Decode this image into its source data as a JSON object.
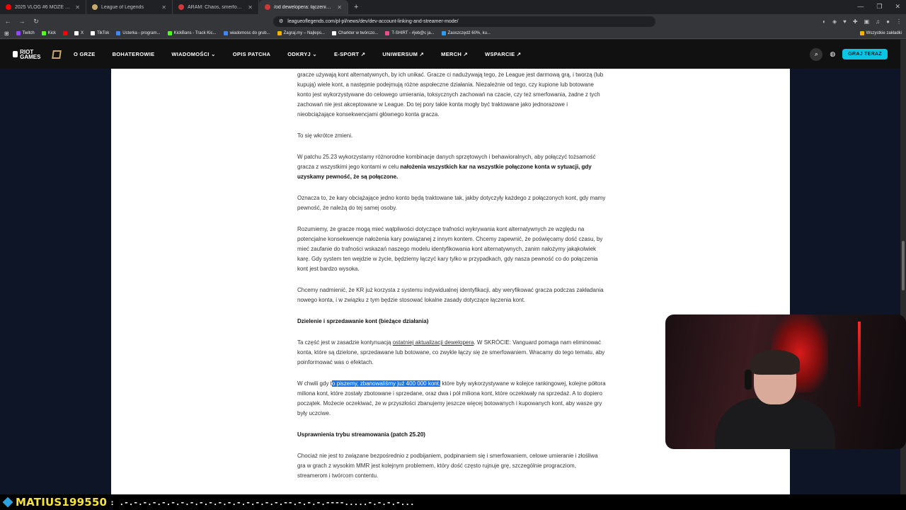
{
  "browser": {
    "tabs": [
      {
        "label": "2025 VLOG #6 MOŻE SIĘ NIE DOWI",
        "color": "#ff0000"
      },
      {
        "label": "League of Legends",
        "color": "#c8aa6e"
      },
      {
        "label": "ARAM: Chaos, smerfowanie i inne ak",
        "color": "#d13639"
      },
      {
        "label": "/od dewelopera: łączenie kont i",
        "color": "#d13639",
        "active": true
      }
    ],
    "url": "leagueoflegends.com/pl-pl/news/dev/dev-account-linking-and-streamer-mode/",
    "bookmarks": [
      {
        "label": "Twitch",
        "color": "#9146ff"
      },
      {
        "label": "Kick",
        "color": "#53fc18"
      },
      {
        "label": "X",
        "color": "#ffffff"
      },
      {
        "label": "TikTok",
        "color": "#ffffff"
      },
      {
        "label": "Usterka - program...",
        "color": "#4285f4"
      },
      {
        "label": "KickBans - Track Kic...",
        "color": "#53fc18"
      },
      {
        "label": "wiadomosc do grub...",
        "color": "#4285f4"
      },
      {
        "label": "Zagraj.my – Najleps...",
        "color": "#f4b400"
      },
      {
        "label": "Charkter w twórczo...",
        "color": "#ffffff"
      },
      {
        "label": "T-SHIRT - #jeb@c ja...",
        "color": "#e84f8a"
      },
      {
        "label": "Zaoszczędź 60%, ku...",
        "color": "#2a9df4"
      }
    ],
    "bookmarks_right": "Wszystkie zakładki"
  },
  "site": {
    "logo_riot": "RIOT GAMES",
    "nav": [
      "O GRZE",
      "BOHATEROWIE",
      "WIADOMOŚCI ⌄",
      "OPIS PATCHA",
      "ODKRYJ ⌄",
      "E-SPORT ↗",
      "UNIWERSUM ↗",
      "MERCH ↗",
      "WSPARCIE ↗"
    ],
    "play_button": "GRAJ TERAZ"
  },
  "article": {
    "p1": "gracze używają kont alternatywnych, by ich unikać. Gracze ci nadużywają tego, że League jest darmową grą, i tworzą (lub kupują) wiele kont, a następnie podejmują różne aspołeczne działania. Niezależnie od tego, czy kupione lub botowane konto jest wykorzystywane do celowego umierania, toksycznych zachowań na czacie, czy też smerfowania, żadne z tych zachowań nie jest akceptowane w League. Do tej pory takie konta mogły być traktowane jako jednorazowe i nieobciążające konsekwencjami głównego konta gracza.",
    "p2": "To się wkrótce zmieni.",
    "p3a": "W patchu 25.23 wykorzystamy różnorodne kombinacje danych sprzętowych i behawioralnych, aby połączyć tożsamość gracza z wszystkimi jego kontami w celu ",
    "p3b": "nałożenia wszystkich kar na wszystkie połączone konta w sytuacji, gdy uzyskamy pewność, że są połączone.",
    "p4": "Oznacza to, że kary obciążające jedno konto będą traktowane tak, jakby dotyczyły każdego z połączonych kont, gdy mamy pewność, że należą do tej samej osoby.",
    "p5": "Rozumiemy, że gracze mogą mieć wątpliwości dotyczące trafności wykrywania kont alternatywnych ze względu na potencjalne konsekwencje nałożenia kary powiązanej z innym kontem. Chcemy zapewnić, że poświęcamy dość czasu, by mieć zaufanie do trafności wskazań naszego modelu identyfikowania kont alternatywnych, zanim nałożymy jakąkolwiek karę. Gdy system ten wejdzie w życie, będziemy łączyć kary tylko w przypadkach, gdy nasza pewność co do połączenia kont jest bardzo wysoka.",
    "p6": "Chcemy nadmienić, że KR już korzysta z systemu indywidualnej identyfikacji, aby weryfikować gracza podczas zakładania nowego konta, i w związku z tym będzie stosować lokalne zasady dotyczące łączenia kont.",
    "h1": "Dzielenie i sprzedawanie kont (bieżące działania)",
    "p7a": "Ta część jest w zasadzie kontynuacją ",
    "p7link": "ostatniej aktualizacji dewelopera",
    "p7b": ". W SKRÓCIE: Vanguard pomaga nam eliminować konta, które są dzielone, sprzedawane lub botowane, co zwykle łączy się ze smerfowaniem. Wracamy do tego tematu, aby poinformować was o efektach.",
    "p8a": "W chwili gdy t",
    "p8hl": "o piszemy, zbanowaliśmy już 400 000 kont,",
    "p8b": " które były wykorzystywane w kolejce rankingowej, kolejne półtora miliona kont, które zostały zbotowane i sprzedane, oraz dwa i pół miliona kont, które oczekiwały na sprzedaż. A to dopiero początek. Możecie oczekiwać, że w przyszłości zbanujemy jeszcze więcej botowanych i kupowanych kont, aby wasze gry były uczciwe.",
    "h2": "Usprawnienia trybu streamowania (patch 25.20)",
    "p9": "Chociaż nie jest to związane bezpośrednio z podbijaniem, podpinaniem się i smerfowaniem, celowe umieranie i złośliwa gra w grach z wysokim MMR jest kolejnym problemem, który dość często rujnuje grę, szczególnie progracziom, streamerom i twórcom contentu."
  },
  "overlay": {
    "username": "MATIUS199550",
    "message": ": .-.-.-.-.-.-.-.-.-.-.-.-.-.-.-.-.-.--.-.-.-.----.....-.-.-.-..."
  }
}
